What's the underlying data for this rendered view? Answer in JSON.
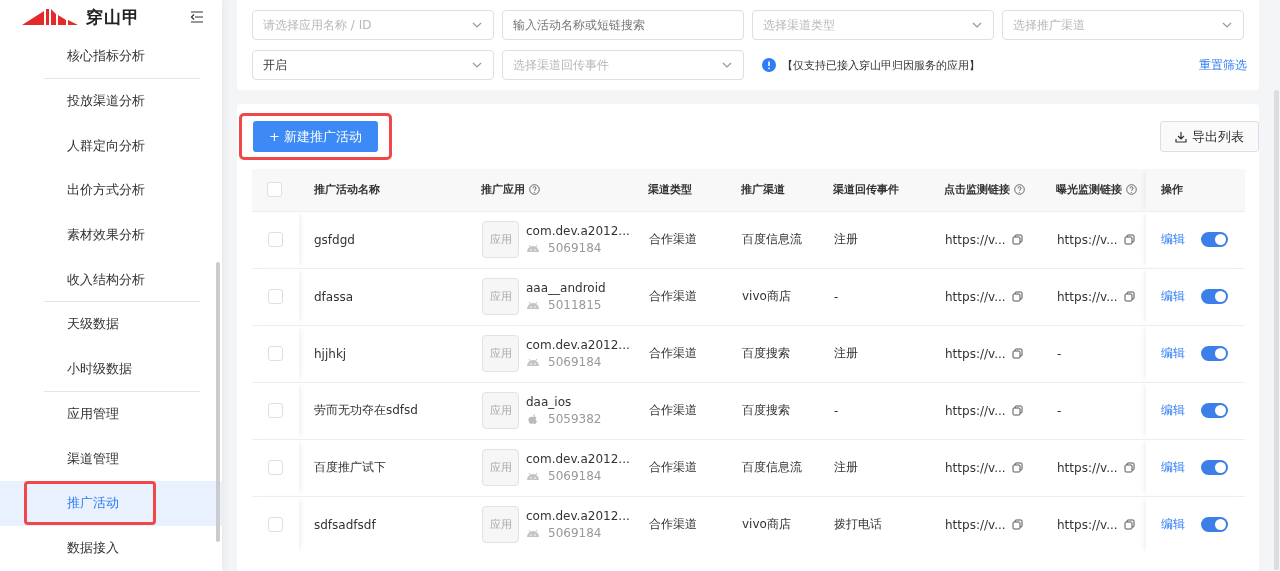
{
  "sidebar": {
    "brand": "穿山甲",
    "items": [
      {
        "label": "核心指标分析",
        "selected": false,
        "divider": true
      },
      {
        "label": "投放渠道分析",
        "selected": false,
        "divider": false
      },
      {
        "label": "人群定向分析",
        "selected": false,
        "divider": false
      },
      {
        "label": "出价方式分析",
        "selected": false,
        "divider": false
      },
      {
        "label": "素材效果分析",
        "selected": false,
        "divider": false
      },
      {
        "label": "收入结构分析",
        "selected": false,
        "divider": true
      },
      {
        "label": "天级数据",
        "selected": false,
        "divider": false
      },
      {
        "label": "小时级数据",
        "selected": false,
        "divider": true
      },
      {
        "label": "应用管理",
        "selected": false,
        "divider": false
      },
      {
        "label": "渠道管理",
        "selected": false,
        "divider": false
      },
      {
        "label": "推广活动",
        "selected": true,
        "divider": false
      },
      {
        "label": "数据接入",
        "selected": false,
        "divider": false
      }
    ]
  },
  "filters": {
    "fields": [
      {
        "kind": "select",
        "placeholder": "请选择应用名称 / ID"
      },
      {
        "kind": "input",
        "placeholder": "输入活动名称或短链搜索"
      },
      {
        "kind": "select",
        "placeholder": "选择渠道类型"
      },
      {
        "kind": "select",
        "placeholder": "选择推广渠道"
      },
      {
        "kind": "select",
        "value": "开启"
      },
      {
        "kind": "select",
        "placeholder": "选择渠道回传事件"
      }
    ],
    "notice": "【仅支持已接入穿山甲归因服务的应用】",
    "reset": "重置筛选"
  },
  "toolbar": {
    "create_button": "+ 新建推广活动",
    "export_button": "导出列表"
  },
  "table": {
    "select_all": {
      "checked": false
    },
    "columns": [
      {
        "label": "推广活动名称",
        "help": false
      },
      {
        "label": "推广应用",
        "help": true
      },
      {
        "label": "渠道类型",
        "help": false
      },
      {
        "label": "推广渠道",
        "help": false
      },
      {
        "label": "渠道回传事件",
        "help": false
      },
      {
        "label": "点击监测链接",
        "help": true
      },
      {
        "label": "曝光监测链接",
        "help": true
      },
      {
        "label": "操作",
        "help": false
      }
    ],
    "rows": [
      {
        "checked": false,
        "name": "gsfdgd",
        "app": {
          "badge": "应用",
          "name": "com.dev.a2012...",
          "kind": "android",
          "id": "5069184"
        },
        "type": "合作渠道",
        "channel": "百度信息流",
        "event": "注册",
        "click_link": {
          "text": "https://v...",
          "copy": true
        },
        "expose_link": {
          "text": "https://v...",
          "copy": true
        },
        "action": "编辑",
        "on": true
      },
      {
        "checked": false,
        "name": "dfassa",
        "app": {
          "badge": "应用",
          "name": "aaa__android",
          "kind": "android",
          "id": "5011815"
        },
        "type": "合作渠道",
        "channel": "vivo商店",
        "event": "-",
        "click_link": {
          "text": "https://v...",
          "copy": true
        },
        "expose_link": {
          "text": "https://v...",
          "copy": true
        },
        "action": "编辑",
        "on": true
      },
      {
        "checked": false,
        "name": "hjjhkj",
        "app": {
          "badge": "应用",
          "name": "com.dev.a2012...",
          "kind": "android",
          "id": "5069184"
        },
        "type": "合作渠道",
        "channel": "百度搜索",
        "event": "注册",
        "click_link": {
          "text": "https://v...",
          "copy": true
        },
        "expose_link": {
          "text": "-",
          "copy": false
        },
        "action": "编辑",
        "on": true
      },
      {
        "checked": false,
        "name": "劳而无功夺在sdfsd",
        "app": {
          "badge": "应用",
          "name": "daa_ios",
          "kind": "ios",
          "id": "5059382"
        },
        "type": "合作渠道",
        "channel": "百度搜索",
        "event": "-",
        "click_link": {
          "text": "https://v...",
          "copy": true
        },
        "expose_link": {
          "text": "-",
          "copy": false
        },
        "action": "编辑",
        "on": true
      },
      {
        "checked": false,
        "name": "百度推广试下",
        "app": {
          "badge": "应用",
          "name": "com.dev.a2012...",
          "kind": "android",
          "id": "5069184"
        },
        "type": "合作渠道",
        "channel": "百度信息流",
        "event": "注册",
        "click_link": {
          "text": "https://v...",
          "copy": true
        },
        "expose_link": {
          "text": "https://v...",
          "copy": true
        },
        "action": "编辑",
        "on": true
      },
      {
        "checked": false,
        "name": "sdfsadfsdf",
        "app": {
          "badge": "应用",
          "name": "com.dev.a2012...",
          "kind": "android",
          "id": "5069184"
        },
        "type": "合作渠道",
        "channel": "vivo商店",
        "event": "拨打电话",
        "click_link": {
          "text": "https://v...",
          "copy": true
        },
        "expose_link": {
          "text": "https://v...",
          "copy": true
        },
        "action": "编辑",
        "on": true
      }
    ]
  }
}
